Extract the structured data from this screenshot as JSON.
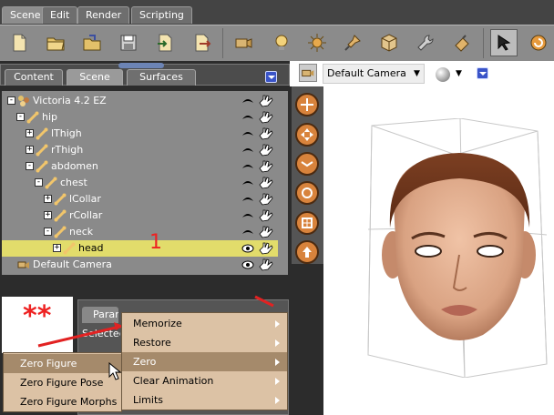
{
  "top_tabs": [
    {
      "label": "Scene",
      "active": true
    },
    {
      "label": "Edit",
      "active": false
    },
    {
      "label": "Render",
      "active": false
    },
    {
      "label": "Scripting",
      "active": false
    }
  ],
  "panel_tabs": [
    {
      "label": "Content",
      "active": false
    },
    {
      "label": "Scene",
      "active": true
    },
    {
      "label": "Surfaces",
      "active": false
    }
  ],
  "tree": [
    {
      "label": "Victoria 4.2 EZ",
      "indent": 0,
      "expander": "-",
      "selected": false,
      "icon": "figure-icon",
      "vis": "dark"
    },
    {
      "label": "hip",
      "indent": 1,
      "expander": "-",
      "selected": false,
      "icon": "bone-icon",
      "vis": "dark"
    },
    {
      "label": "lThigh",
      "indent": 2,
      "expander": "+",
      "selected": false,
      "icon": "bone-icon",
      "vis": "dark"
    },
    {
      "label": "rThigh",
      "indent": 2,
      "expander": "+",
      "selected": false,
      "icon": "bone-icon",
      "vis": "dark"
    },
    {
      "label": "abdomen",
      "indent": 2,
      "expander": "-",
      "selected": false,
      "icon": "bone-icon",
      "vis": "dark"
    },
    {
      "label": "chest",
      "indent": 3,
      "expander": "-",
      "selected": false,
      "icon": "bone-icon",
      "vis": "dark"
    },
    {
      "label": "lCollar",
      "indent": 4,
      "expander": "+",
      "selected": false,
      "icon": "bone-icon",
      "vis": "dark"
    },
    {
      "label": "rCollar",
      "indent": 4,
      "expander": "+",
      "selected": false,
      "icon": "bone-icon",
      "vis": "dark"
    },
    {
      "label": "neck",
      "indent": 4,
      "expander": "-",
      "selected": false,
      "icon": "bone-icon",
      "vis": "dark"
    },
    {
      "label": "head",
      "indent": 5,
      "expander": "+",
      "selected": true,
      "icon": "bone-icon",
      "vis": "eye"
    },
    {
      "label": "Default Camera",
      "indent": 0,
      "expander": "",
      "selected": false,
      "icon": "camera-icon",
      "vis": "eye"
    }
  ],
  "annotations": {
    "number": "1",
    "stars": "**"
  },
  "params": {
    "tab_label": "Parameters",
    "selected_label": "Selected"
  },
  "context_menu": [
    {
      "label": "Memorize",
      "highlighted": false
    },
    {
      "label": "Restore",
      "highlighted": false
    },
    {
      "label": "Zero",
      "highlighted": true
    },
    {
      "label": "Clear Animation",
      "highlighted": false
    },
    {
      "label": "Limits",
      "highlighted": false
    }
  ],
  "submenu": [
    {
      "label": "Zero Figure",
      "highlighted": true
    },
    {
      "label": "Zero Figure Pose",
      "highlighted": false
    },
    {
      "label": "Zero Figure Morphs",
      "highlighted": false
    }
  ],
  "viewport": {
    "camera_label": "Default Camera"
  },
  "colors": {
    "selection": "#e2dc6b",
    "menu_bg": "#dcc2a5",
    "menu_hl": "#a58a6b",
    "accent": "#3a54c8",
    "annotation": "#e22222"
  },
  "toolbar_icons": [
    "new-file-icon",
    "open-folder-icon",
    "open-folder-alt-icon",
    "save-icon",
    "import-icon",
    "export-icon",
    "camera-tool-icon",
    "light-bulb-icon",
    "sun-light-icon",
    "pin-light-icon",
    "cube-icon",
    "wrench-icon",
    "pointer-tool-icon",
    "select-arrow-icon",
    "rotate-icon"
  ]
}
